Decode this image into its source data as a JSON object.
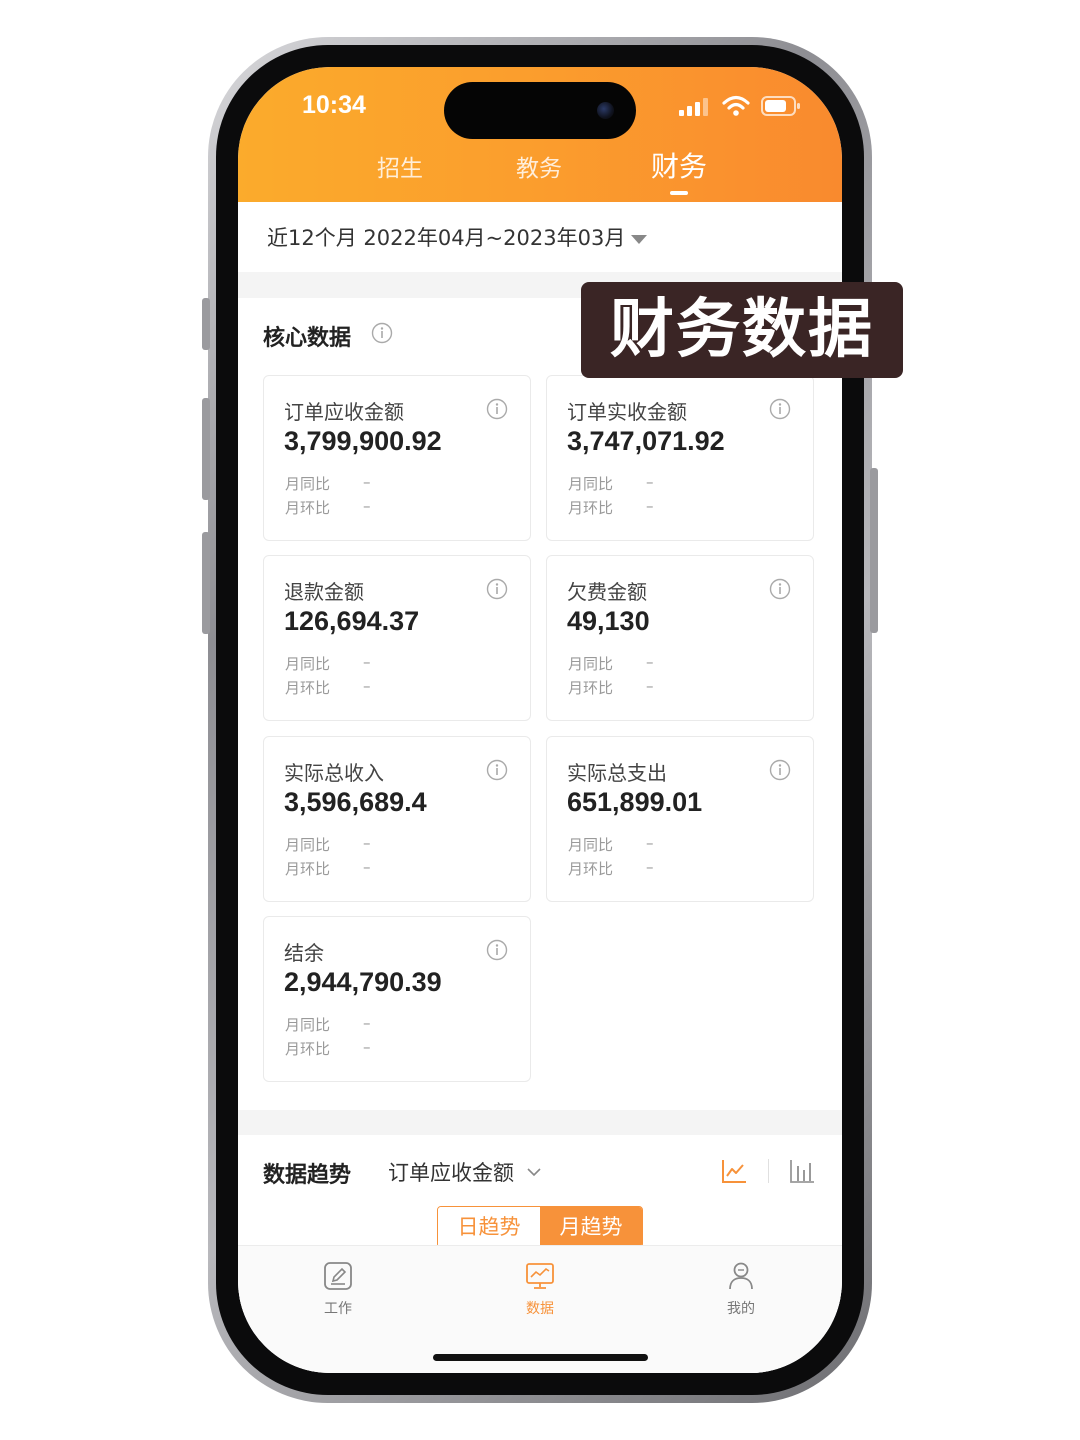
{
  "status_bar": {
    "time": "10:34"
  },
  "top_tabs": [
    {
      "label": "招生",
      "active": false
    },
    {
      "label": "教务",
      "active": false
    },
    {
      "label": "财务",
      "active": true
    }
  ],
  "date_filter": {
    "label": "近12个月 2022年04月~2023年03月"
  },
  "overlay": {
    "text": "财务数据"
  },
  "core": {
    "title": "核心数据",
    "cards": [
      {
        "label": "订单应收金额",
        "value": "3,799,900.92",
        "yoy_label": "月同比",
        "yoy_value": "–",
        "mom_label": "月环比",
        "mom_value": "–"
      },
      {
        "label": "订单实收金额",
        "value": "3,747,071.92",
        "yoy_label": "月同比",
        "yoy_value": "–",
        "mom_label": "月环比",
        "mom_value": "–"
      },
      {
        "label": "退款金额",
        "value": "126,694.37",
        "yoy_label": "月同比",
        "yoy_value": "–",
        "mom_label": "月环比",
        "mom_value": "–"
      },
      {
        "label": "欠费金额",
        "value": "49,130",
        "yoy_label": "月同比",
        "yoy_value": "–",
        "mom_label": "月环比",
        "mom_value": "–"
      },
      {
        "label": "实际总收入",
        "value": "3,596,689.4",
        "yoy_label": "月同比",
        "yoy_value": "–",
        "mom_label": "月环比",
        "mom_value": "–"
      },
      {
        "label": "实际总支出",
        "value": "651,899.01",
        "yoy_label": "月同比",
        "yoy_value": "–",
        "mom_label": "月环比",
        "mom_value": "–"
      },
      {
        "label": "结余",
        "value": "2,944,790.39",
        "yoy_label": "月同比",
        "yoy_value": "–",
        "mom_label": "月环比",
        "mom_value": "–"
      }
    ]
  },
  "trend": {
    "title": "数据趋势",
    "metric": "订单应收金额",
    "segments": {
      "day": "日趋势",
      "month": "月趋势",
      "selected": "month"
    }
  },
  "bottom_nav": [
    {
      "label": "工作",
      "icon": "edit-icon",
      "active": false
    },
    {
      "label": "数据",
      "icon": "data-monitor-icon",
      "active": true
    },
    {
      "label": "我的",
      "icon": "profile-icon",
      "active": false
    }
  ],
  "colors": {
    "accent": "#f7923a",
    "header_start": "#fbab2c",
    "header_end": "#f98a2e",
    "overlay_bg": "#3a2525"
  }
}
